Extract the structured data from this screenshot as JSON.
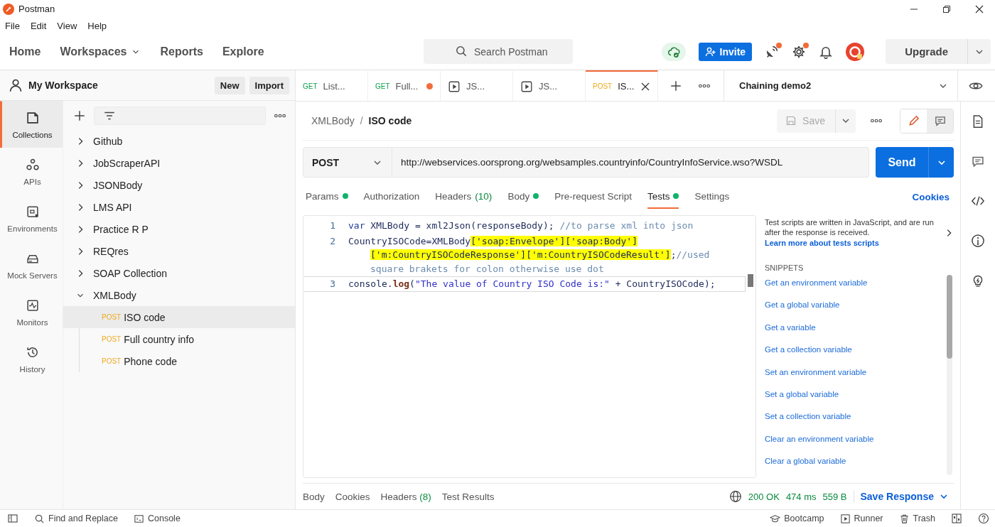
{
  "window": {
    "title": "Postman"
  },
  "menu": [
    "File",
    "Edit",
    "View",
    "Help"
  ],
  "header": {
    "nav": [
      {
        "label": "Home",
        "dropdown": false
      },
      {
        "label": "Workspaces",
        "dropdown": true
      },
      {
        "label": "Reports",
        "dropdown": false
      },
      {
        "label": "Explore",
        "dropdown": false
      }
    ],
    "search": {
      "placeholder": "Search Postman"
    },
    "invite": "Invite",
    "notifications": [
      {
        "kind": "satellite",
        "unread": true
      },
      {
        "kind": "settings",
        "unread": true
      },
      {
        "kind": "bell",
        "unread": false
      }
    ],
    "upgrade": "Upgrade"
  },
  "workspace": {
    "name": "My Workspace",
    "buttons": [
      "New",
      "Import"
    ]
  },
  "nav_rail": [
    {
      "label": "Collections",
      "selected": true
    },
    {
      "label": "APIs",
      "selected": false
    },
    {
      "label": "Environments",
      "selected": false
    },
    {
      "label": "Mock Servers",
      "selected": false
    },
    {
      "label": "Monitors",
      "selected": false
    },
    {
      "label": "History",
      "selected": false
    }
  ],
  "collections": [
    {
      "name": "Github",
      "expanded": false
    },
    {
      "name": "JobScraperAPI",
      "expanded": false
    },
    {
      "name": "JSONBody",
      "expanded": false
    },
    {
      "name": "LMS API",
      "expanded": false
    },
    {
      "name": "Practice R P",
      "expanded": false
    },
    {
      "name": "REQres",
      "expanded": false
    },
    {
      "name": "SOAP Collection",
      "expanded": false
    },
    {
      "name": "XMLBody",
      "expanded": true,
      "children": [
        {
          "method": "POST",
          "name": "ISO code",
          "selected": true
        },
        {
          "method": "POST",
          "name": "Full country info",
          "selected": false
        },
        {
          "method": "POST",
          "name": "Phone code",
          "selected": false
        }
      ]
    }
  ],
  "tabs": [
    {
      "kind": "request",
      "method": "GET",
      "label": "List...",
      "unsaved": false,
      "selected": false
    },
    {
      "kind": "request",
      "method": "GET",
      "label": "Full...",
      "unsaved": true,
      "selected": false
    },
    {
      "kind": "runner",
      "label": "JS...",
      "unsaved": false,
      "selected": false
    },
    {
      "kind": "runner",
      "label": "JS...",
      "unsaved": false,
      "selected": false
    },
    {
      "kind": "request",
      "method": "POST",
      "label": "IS...",
      "unsaved": false,
      "selected": true
    }
  ],
  "environment": "Chaining demo2",
  "breadcrumb": {
    "parent": "XMLBody",
    "separator": "/",
    "current": "ISO code"
  },
  "save": {
    "label": "Save",
    "disabled": true
  },
  "mode_toggle": [
    {
      "selected": true
    },
    {
      "selected": false
    }
  ],
  "request": {
    "method": "POST",
    "url": "http://webservices.oorsprong.org/websamples.countryinfo/CountryInfoService.wso?WSDL",
    "send": "Send"
  },
  "request_tabs": [
    {
      "label": "Params",
      "dot": true,
      "selected": false
    },
    {
      "label": "Authorization",
      "dot": false,
      "selected": false
    },
    {
      "label": "Headers",
      "count": "(10)",
      "dot": false,
      "selected": false
    },
    {
      "label": "Body",
      "dot": true,
      "selected": false
    },
    {
      "label": "Pre-request Script",
      "dot": false,
      "selected": false
    },
    {
      "label": "Tests",
      "dot": true,
      "selected": true
    },
    {
      "label": "Settings",
      "dot": false,
      "selected": false
    }
  ],
  "cookies": "Cookies",
  "code": [
    {
      "number": "1",
      "active": false,
      "rows": [
        {
          "tokens": [
            {
              "kind": "keyword",
              "text": "var"
            },
            {
              "kind": "plain",
              "text": " XMLBody = xml2Json(responseBody); "
            },
            {
              "kind": "comment",
              "text": "//to parse xml into json"
            }
          ]
        }
      ]
    },
    {
      "number": "2",
      "active": false,
      "rows": [
        {
          "tokens": [
            {
              "kind": "plain",
              "text": "CountryISOCode=XMLBody"
            },
            {
              "kind": "plain",
              "text": "['soap:Envelope']['soap:Body']",
              "highlighted": true
            }
          ]
        },
        {
          "tokens": [
            {
              "kind": "plain",
              "text": "['m:CountryISOCodeResponse']['m:CountryISOCodeResult']",
              "highlighted": true
            },
            {
              "kind": "plain",
              "text": ";"
            },
            {
              "kind": "comment",
              "text": "//used"
            }
          ]
        },
        {
          "tokens": [
            {
              "kind": "comment",
              "text": "square brakets for colon otherwise use dot"
            }
          ]
        }
      ]
    },
    {
      "number": "3",
      "active": true,
      "rows": [
        {
          "tokens": [
            {
              "kind": "plain",
              "text": "console."
            },
            {
              "kind": "method",
              "text": "log"
            },
            {
              "kind": "plain",
              "text": "("
            },
            {
              "kind": "string",
              "text": "\"The value of Country ISO Code is:\""
            },
            {
              "kind": "plain",
              "text": " + CountryISOCode);"
            }
          ]
        }
      ]
    }
  ],
  "help": {
    "text": "Test scripts are written in JavaScript, and are run after the response is received.",
    "link": "Learn more about tests scripts"
  },
  "snippets": {
    "title": "SNIPPETS",
    "items": [
      "Get an environment variable",
      "Get a global variable",
      "Get a variable",
      "Get a collection variable",
      "Set an environment variable",
      "Set a global variable",
      "Set a collection variable",
      "Clear an environment variable",
      "Clear a global variable"
    ]
  },
  "response": {
    "tabs": [
      {
        "label": "Body"
      },
      {
        "label": "Cookies"
      },
      {
        "label": "Headers",
        "count": "(8)"
      },
      {
        "label": "Test Results"
      }
    ],
    "status": "200 OK",
    "time": "474 ms",
    "size": "559 B",
    "save": "Save Response"
  },
  "status_bar": {
    "left": [
      {
        "label": "Find and Replace"
      },
      {
        "label": "Console"
      }
    ],
    "right": [
      {
        "label": "Bootcamp"
      },
      {
        "label": "Runner"
      },
      {
        "label": "Trash"
      }
    ]
  }
}
